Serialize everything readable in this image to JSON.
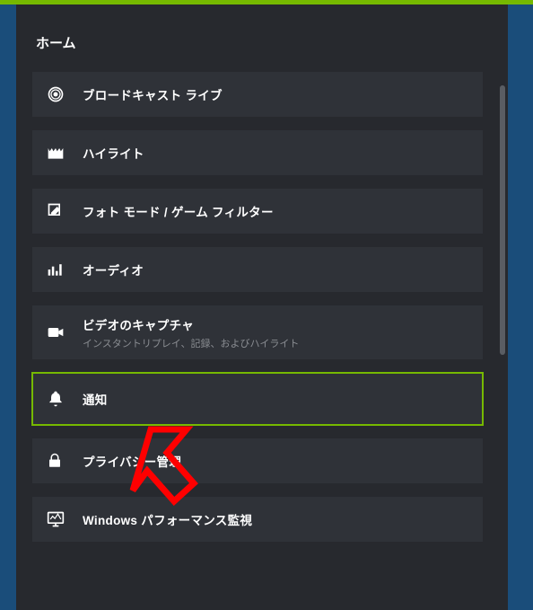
{
  "colors": {
    "accent": "#76b900",
    "panel": "#27292e",
    "item": "#2f3238",
    "arrow": "#ff0000"
  },
  "header": {
    "title": "ホーム"
  },
  "items": [
    {
      "id": "broadcast",
      "icon": "broadcast-icon",
      "label": "ブロードキャスト ライブ",
      "sublabel": ""
    },
    {
      "id": "highlight",
      "icon": "clapper-icon",
      "label": "ハイライト",
      "sublabel": ""
    },
    {
      "id": "photomode",
      "icon": "edit-icon",
      "label": "フォト モード / ゲーム フィルター",
      "sublabel": ""
    },
    {
      "id": "audio",
      "icon": "equalizer-icon",
      "label": "オーディオ",
      "sublabel": ""
    },
    {
      "id": "capture",
      "icon": "camera-icon",
      "label": "ビデオのキャプチャ",
      "sublabel": "インスタントリプレイ、記録、およびハイライト"
    },
    {
      "id": "notify",
      "icon": "bell-icon",
      "label": "通知",
      "sublabel": "",
      "highlight": true
    },
    {
      "id": "privacy",
      "icon": "lock-icon",
      "label": "プライバシー管理",
      "sublabel": ""
    },
    {
      "id": "perfmon",
      "icon": "monitor-icon",
      "label": "Windows パフォーマンス監視",
      "sublabel": ""
    }
  ]
}
